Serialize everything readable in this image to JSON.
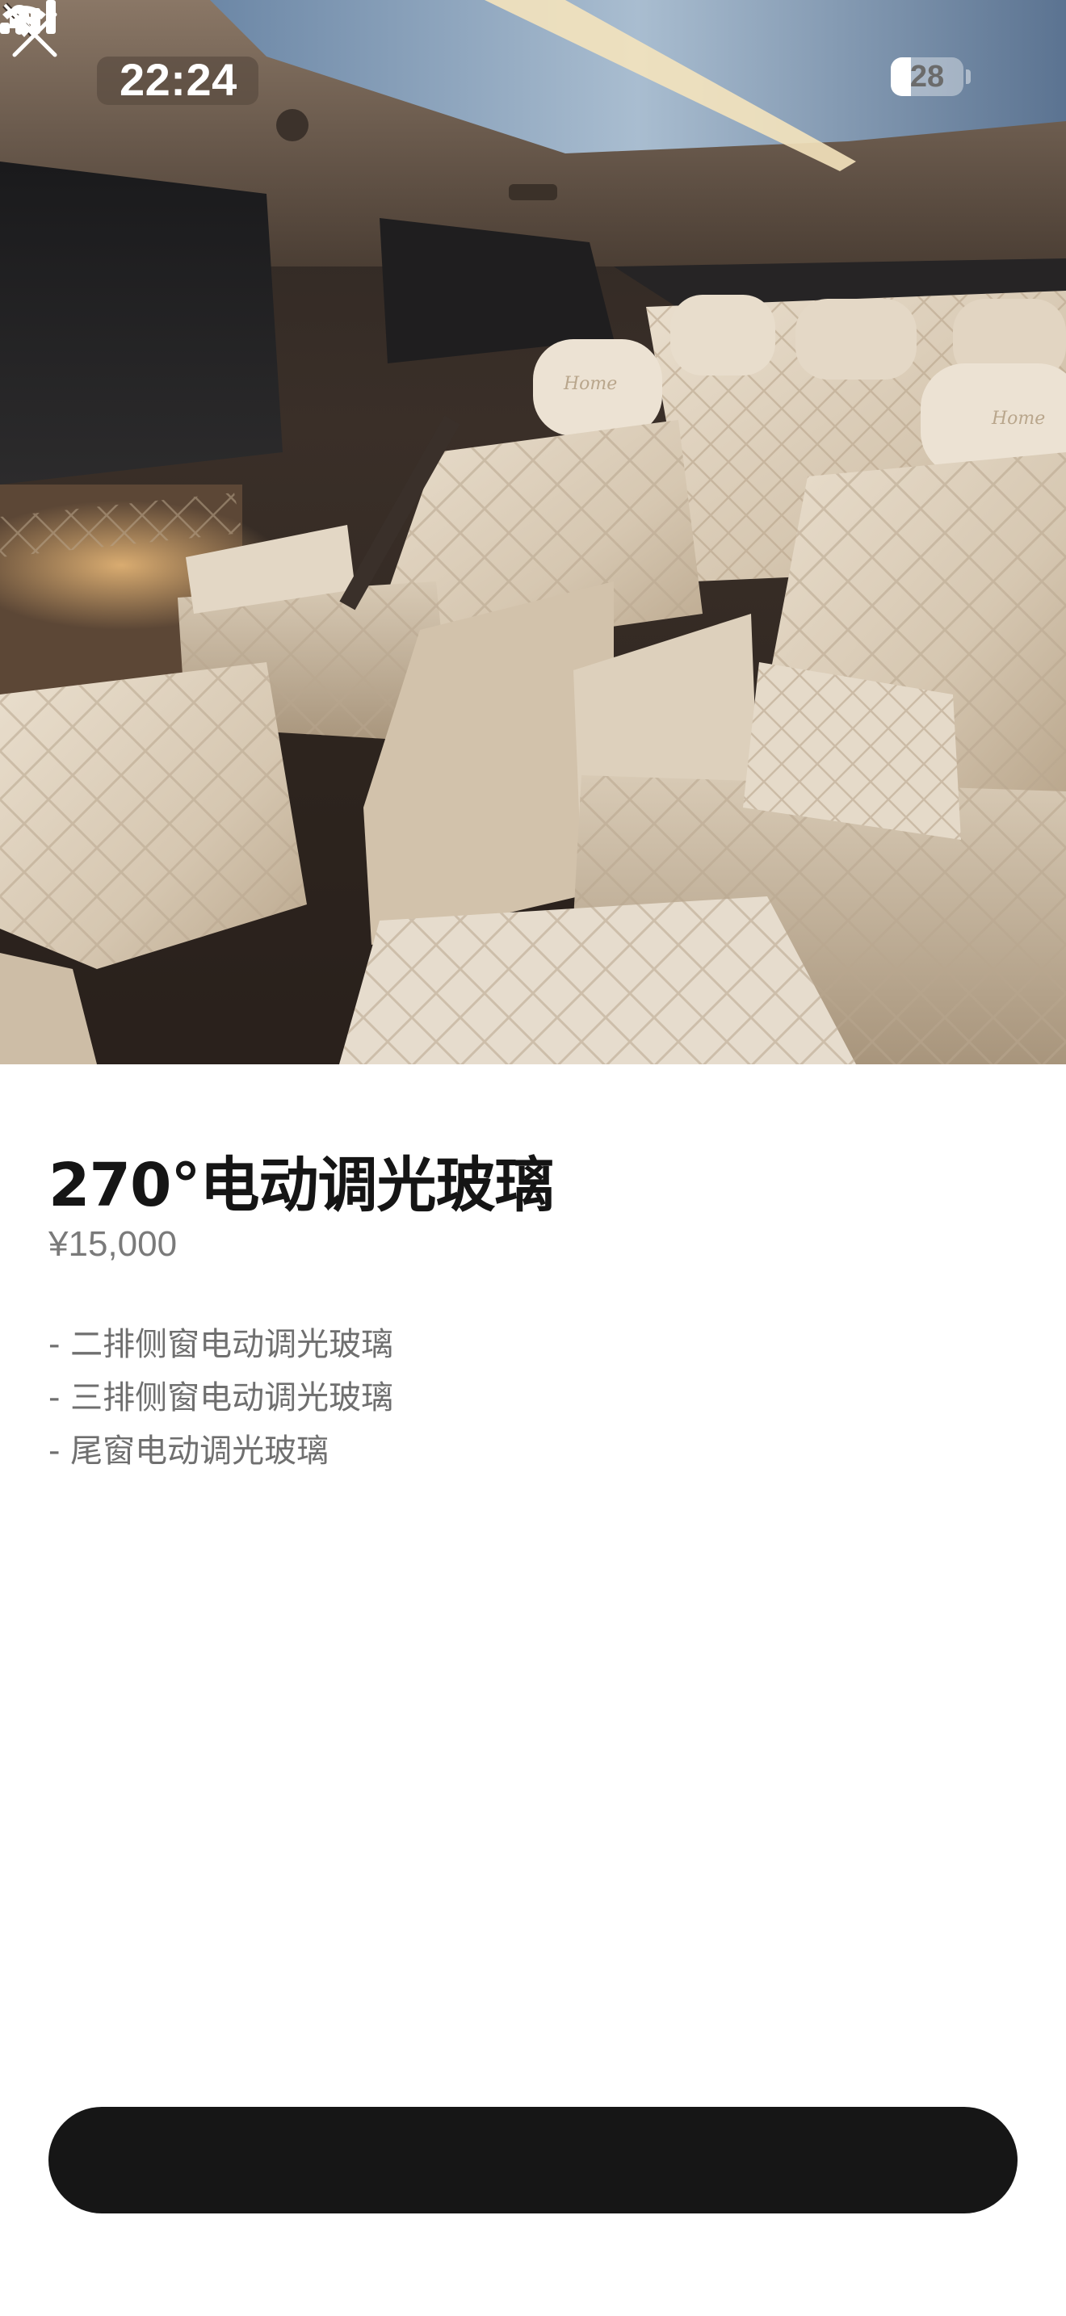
{
  "status_bar": {
    "time": "22:24",
    "battery_level": "28",
    "battery_fraction": 0.28,
    "icons": [
      "bell-slash-icon",
      "cellular-signal-icon",
      "wifi-icon",
      "battery-icon"
    ]
  },
  "hero": {
    "icon": "close-icon",
    "headrest_logo_text": "Home"
  },
  "product": {
    "title": "270°电动调光玻璃",
    "price": "¥15,000",
    "features": [
      "- 二排侧窗电动调光玻璃",
      "- 三排侧窗电动调光玻璃",
      "- 尾窗电动调光玻璃"
    ]
  },
  "footer": {
    "cta_label": ""
  },
  "colors": {
    "background": "#ffffff",
    "title_text": "#151515",
    "secondary_text": "#7a7a7a",
    "cta_background": "#161616",
    "upholstery": "#d9cbb6"
  }
}
